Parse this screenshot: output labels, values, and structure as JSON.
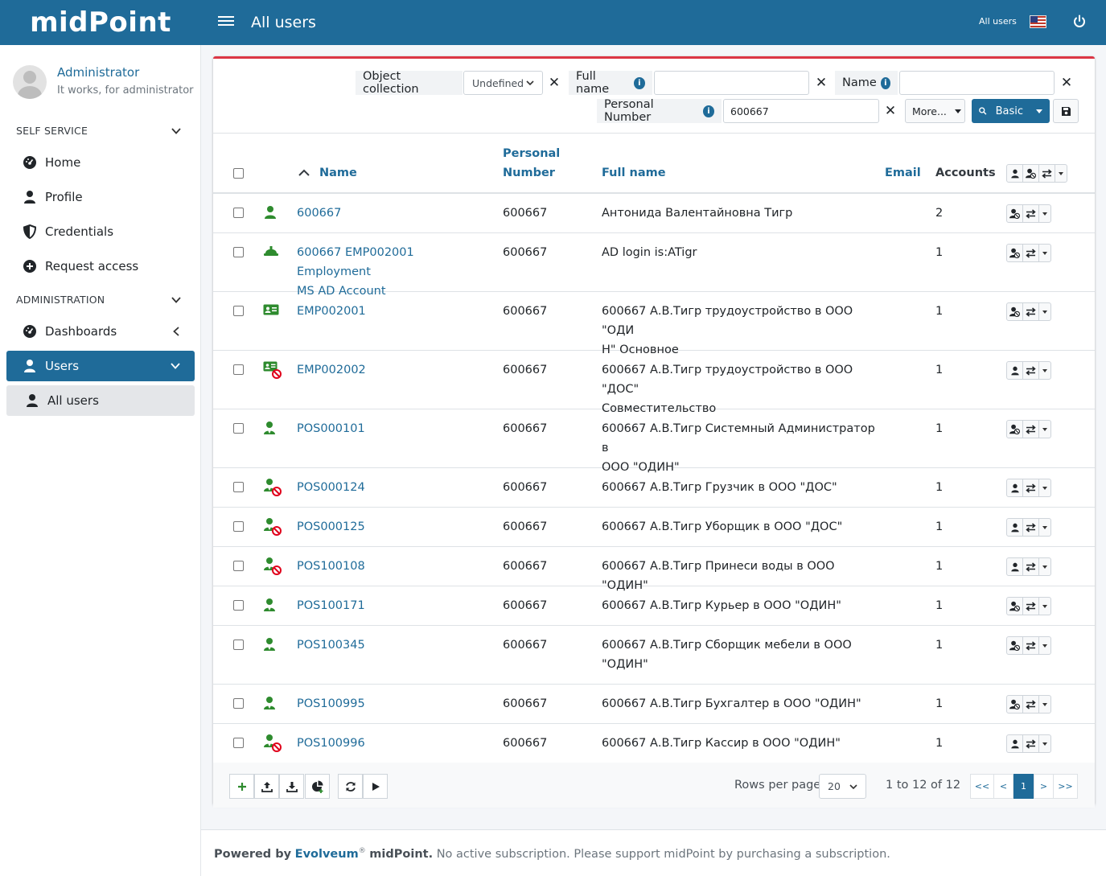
{
  "app": {
    "brand": "midPoint",
    "page_title": "All users",
    "top_right_label": "All users"
  },
  "sidebar": {
    "user_name": "Administrator",
    "user_subtitle": "It works, for administrator",
    "self_service_header": "SELF SERVICE",
    "self_service_items": [
      "Home",
      "Profile",
      "Credentials",
      "Request access"
    ],
    "administration_header": "ADMINISTRATION",
    "dashboards": "Dashboards",
    "users": "Users",
    "all_users": "All users"
  },
  "search": {
    "object_collection_label": "Object collection",
    "object_collection_value": "Undefined",
    "full_name_label": "Full name",
    "full_name_value": "",
    "name_label": "Name",
    "name_value": "",
    "personal_number_label": "Personal Number",
    "personal_number_value": "600667",
    "more_label": "More...",
    "basic_label": "Basic"
  },
  "table": {
    "headers": {
      "name": "Name",
      "personal_number_1": "Personal",
      "personal_number_2": "Number",
      "full_name": "Full name",
      "email": "Email",
      "accounts": "Accounts"
    },
    "rows": [
      {
        "icon": "user-icon",
        "name": "600667",
        "name2": "",
        "pn": "600667",
        "full": "Антонида Валентайновна Тигр",
        "full2": "",
        "accounts": "2",
        "action_icon": "user-slash-icon"
      },
      {
        "icon": "hard-hat-icon",
        "name": "600667 EMP002001 Employment",
        "name2": "MS AD Account",
        "pn": "600667",
        "full": "AD login is:ATigr",
        "full2": "",
        "accounts": "1",
        "action_icon": "user-slash-icon"
      },
      {
        "icon": "id-card-icon",
        "name": "EMP002001",
        "name2": "",
        "pn": "600667",
        "full": "600667 А.В.Тигр трудоустройство в ООО \"ОДИ",
        "full2": "Н\" Основное",
        "accounts": "1",
        "action_icon": "user-slash-icon"
      },
      {
        "icon": "id-card-disabled-icon",
        "name": "EMP002002",
        "name2": "",
        "pn": "600667",
        "full": "600667 А.В.Тигр трудоустройство в ООО \"ДОС\"",
        "full2": "Совместительство",
        "accounts": "1",
        "action_icon": "user-icon"
      },
      {
        "icon": "user-tie-icon",
        "name": "POS000101",
        "name2": "",
        "pn": "600667",
        "full": "600667 А.В.Тигр Системный Администратор в",
        "full2": "ООО \"ОДИН\"",
        "accounts": "1",
        "action_icon": "user-slash-icon"
      },
      {
        "icon": "user-tie-disabled-icon",
        "name": "POS000124",
        "name2": "",
        "pn": "600667",
        "full": "600667 А.В.Тигр Грузчик в ООО \"ДОС\"",
        "full2": "",
        "accounts": "1",
        "action_icon": "user-icon"
      },
      {
        "icon": "user-tie-disabled-icon",
        "name": "POS000125",
        "name2": "",
        "pn": "600667",
        "full": "600667 А.В.Тигр Уборщик в ООО \"ДОС\"",
        "full2": "",
        "accounts": "1",
        "action_icon": "user-icon"
      },
      {
        "icon": "user-tie-disabled-icon",
        "name": "POS100108",
        "name2": "",
        "pn": "600667",
        "full": "600667 А.В.Тигр Принеси воды в ООО \"ОДИН\"",
        "full2": "",
        "accounts": "1",
        "action_icon": "user-icon"
      },
      {
        "icon": "user-tie-icon",
        "name": "POS100171",
        "name2": "",
        "pn": "600667",
        "full": "600667 А.В.Тигр Курьер в ООО \"ОДИН\"",
        "full2": "",
        "accounts": "1",
        "action_icon": "user-slash-icon"
      },
      {
        "icon": "user-tie-icon",
        "name": "POS100345",
        "name2": "",
        "pn": "600667",
        "full": "600667 А.В.Тигр Сборщик мебели в ООО",
        "full2": "\"ОДИН\"",
        "accounts": "1",
        "action_icon": "user-slash-icon"
      },
      {
        "icon": "user-tie-icon",
        "name": "POS100995",
        "name2": "",
        "pn": "600667",
        "full": "600667 А.В.Тигр Бухгалтер в ООО \"ОДИН\"",
        "full2": "",
        "accounts": "1",
        "action_icon": "user-slash-icon"
      },
      {
        "icon": "user-tie-disabled-icon",
        "name": "POS100996",
        "name2": "",
        "pn": "600667",
        "full": "600667 А.В.Тигр Кассир в ООО \"ОДИН\"",
        "full2": "",
        "accounts": "1",
        "action_icon": "user-icon"
      }
    ]
  },
  "pagination": {
    "rows_per_page_label": "Rows per page",
    "rows_per_page_value": "20",
    "range": "1 to 12 of 12",
    "first": "<<",
    "prev": "<",
    "current": "1",
    "next": ">",
    "last": ">>"
  },
  "footer": {
    "powered_by": "Powered by",
    "vendor": "Evolveum",
    "reg": "®",
    "product": "midPoint.",
    "message": "No active subscription. Please support midPoint by purchasing a subscription."
  },
  "colors": {
    "brand": "#1f6b99",
    "accent_red": "#dc3545",
    "icon_green": "#2e8b2e",
    "disabled_red": "#e0001b"
  }
}
